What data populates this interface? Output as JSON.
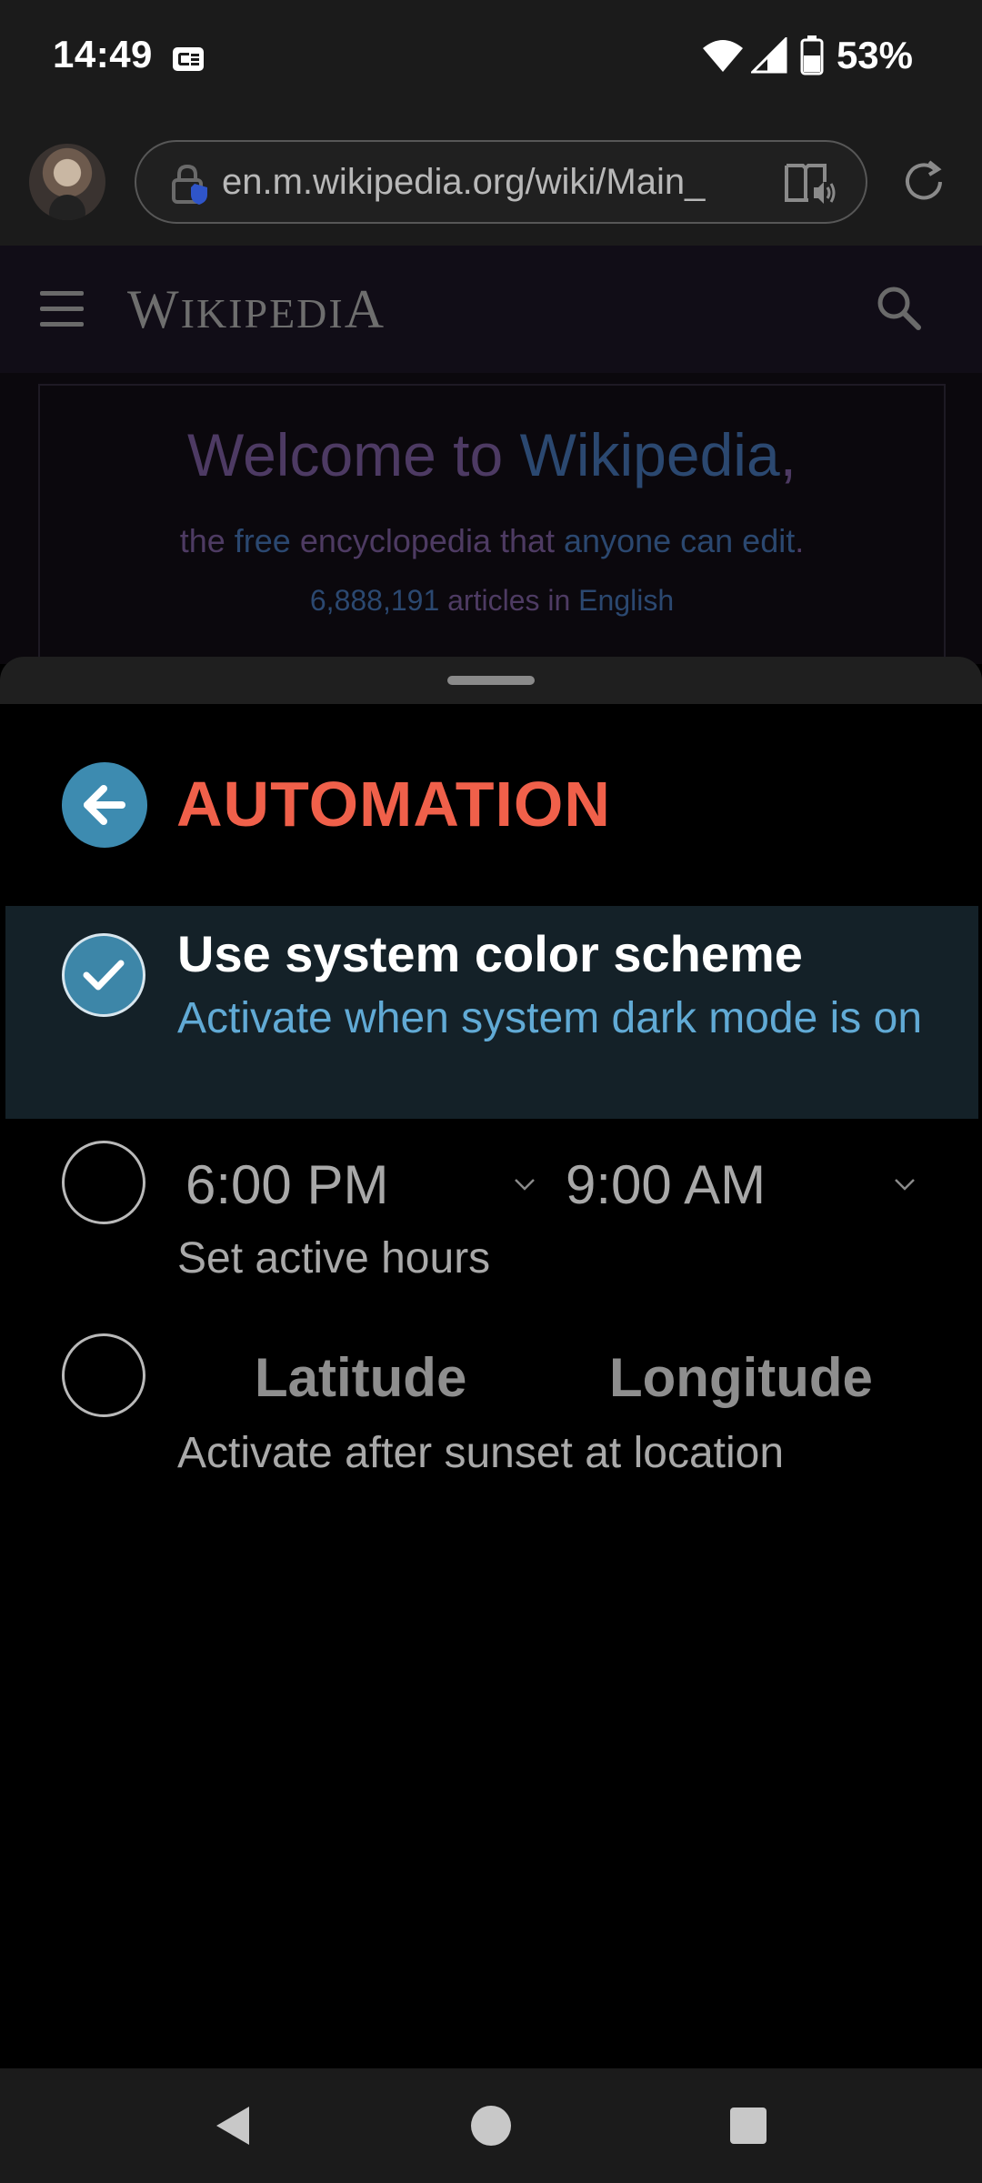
{
  "status_bar": {
    "time": "14:49",
    "battery": "53%",
    "icons": [
      "screen-record-icon",
      "wifi-icon",
      "signal-icon",
      "battery-icon"
    ]
  },
  "browser": {
    "url": "en.m.wikipedia.org/wiki/Main_",
    "icons": [
      "profile-avatar",
      "site-security-icon",
      "reader-mode-icon",
      "refresh-icon"
    ]
  },
  "wiki": {
    "logo_first": "W",
    "logo_rest": "IKIPEDI",
    "logo_last": "A",
    "welcome_prefix": "Welcome to ",
    "welcome_link": "Wikipedia",
    "welcome_suffix": ",",
    "sub_prefix": "the ",
    "sub_link": "free",
    "sub_middle": " encyclopedia that ",
    "sub_link2": "anyone can edit",
    "sub_suffix": ".",
    "count_link": "6,888,191",
    "count_middle": " articles in ",
    "count_lang": "English"
  },
  "sheet": {
    "title": "AUTOMATION",
    "options": [
      {
        "title": "Use system color scheme",
        "subtitle": "Activate when system dark mode is on",
        "selected": true
      },
      {
        "start_time": "6:00 PM",
        "end_time": "9:00 AM",
        "subtitle": "Set active hours",
        "selected": false
      },
      {
        "latitude_label": "Latitude",
        "longitude_label": "Longitude",
        "subtitle": "Activate after sunset at location",
        "selected": false
      }
    ]
  },
  "colors": {
    "accent": "#3d8bb0",
    "title": "#f0604a",
    "selected_bg": "#142128",
    "selected_sub": "#61aad5"
  }
}
